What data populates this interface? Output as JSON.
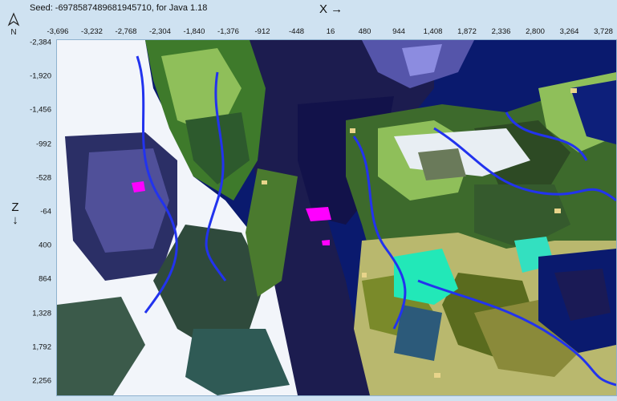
{
  "header": {
    "seed_text": "Seed: -6978587489681945710, for Java 1.18",
    "x_axis_label": "X →",
    "z_axis_label": "Z ↓",
    "compass_label": "N"
  },
  "x_ticks": [
    "-3,696",
    "-3,232",
    "-2,768",
    "-2,304",
    "-1,840",
    "-1,376",
    "-912",
    "-448",
    "16",
    "480",
    "944",
    "1,408",
    "1,872",
    "2,336",
    "2,800",
    "3,264",
    "3,728"
  ],
  "z_ticks": [
    "-2,384",
    "-1,920",
    "-1,456",
    "-992",
    "-528",
    "-64",
    "400",
    "864",
    "1,328",
    "1,792",
    "2,256"
  ],
  "biome_colors": {
    "deep_ocean": "#0a1a6e",
    "ocean": "#1a2a9a",
    "dark_ocean": "#1d1d55",
    "plains": "#8fbf5a",
    "forest": "#3d7a2a",
    "dark_forest": "#2b4a1e",
    "snow": "#f4f7fb",
    "ice": "#a9a4e8",
    "taiga": "#3b5a4a",
    "swamp": "#5a6b1e",
    "savanna": "#b5b26a",
    "desert": "#e8d48a",
    "river": "#2233ee",
    "mushroom": "#ff00ff",
    "lukewarm": "#22e8b8"
  }
}
